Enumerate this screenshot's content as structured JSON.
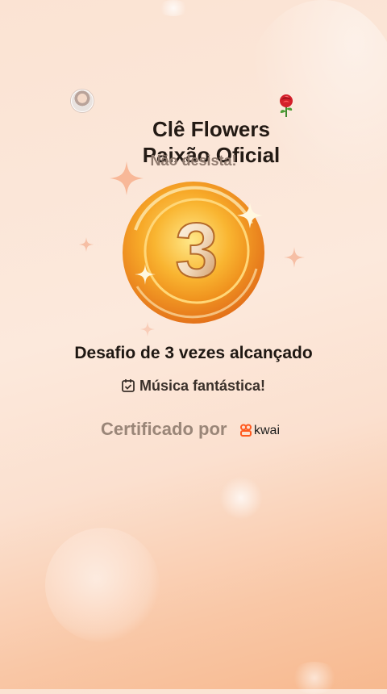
{
  "colors": {
    "background_top": "#fbe3d3",
    "background_bottom": "#f7b98f",
    "medal_gold": "#f5a623",
    "brand_orange": "#ff5a1f"
  },
  "icons": {
    "avatar": "user-avatar",
    "rose": "rose-emoji",
    "checklist": "calendar-check-icon",
    "brand_logo": "kwai-logo"
  },
  "header": {
    "title": "Clê Flowers\nPaixão Oficial"
  },
  "subtitle": "Não desista!",
  "medal": {
    "number": "3"
  },
  "achievement": "Desafio de 3 vezes alcançado",
  "song_label": "Música fantástica!",
  "certified": {
    "label": "Certificado por",
    "brand": "kwai"
  }
}
